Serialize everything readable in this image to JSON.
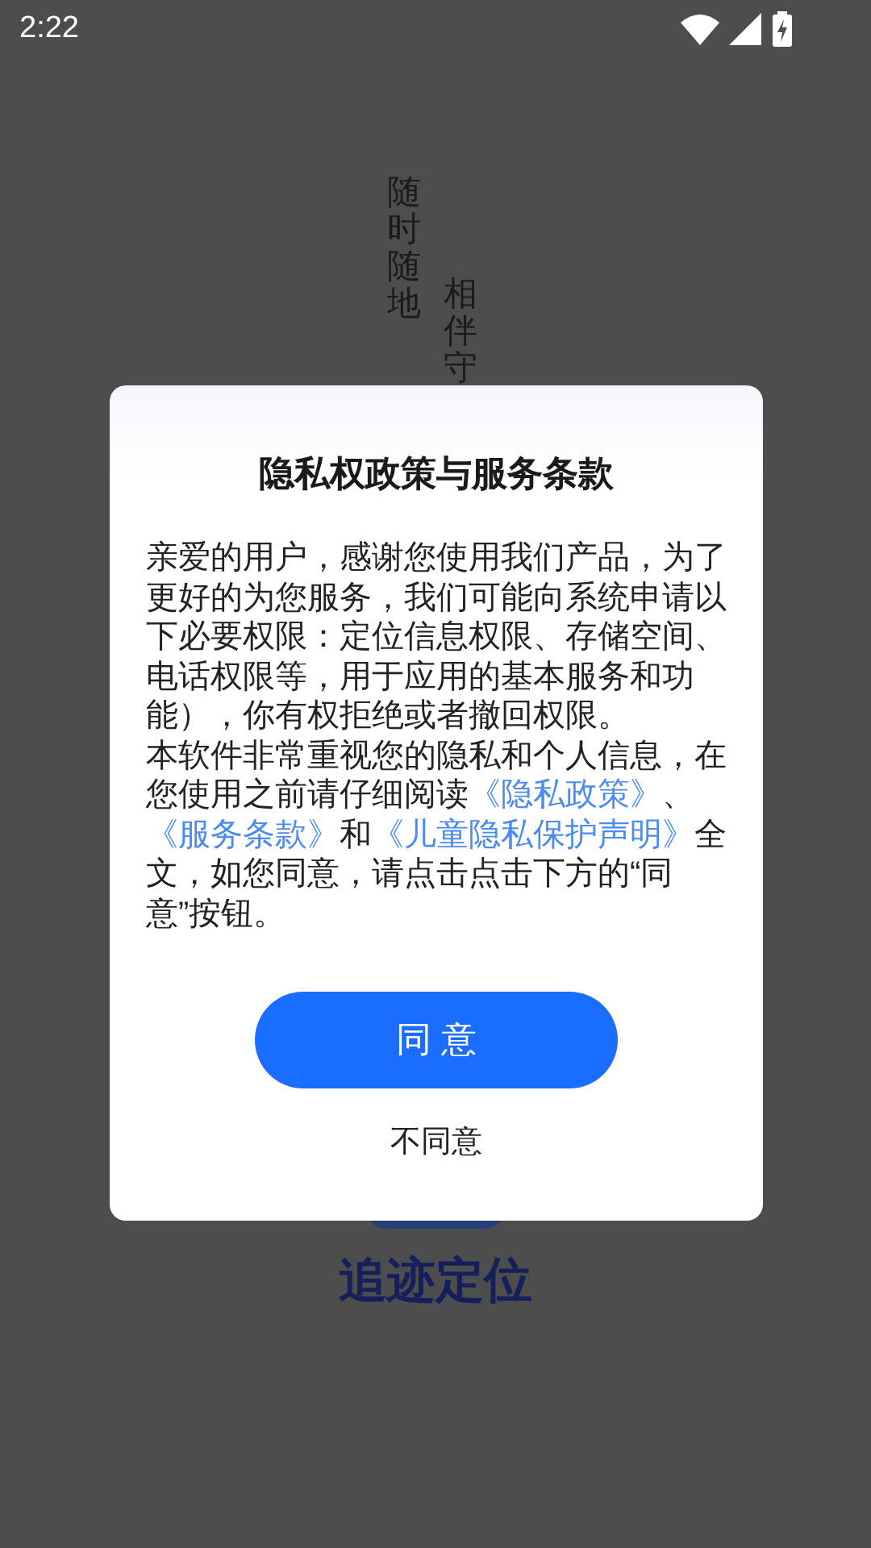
{
  "status_bar": {
    "time": "2:22"
  },
  "background": {
    "slogan_columns": [
      "随时随地",
      "相伴守"
    ],
    "title": "追迹定位"
  },
  "dialog": {
    "title": "隐私权政策与服务条款",
    "paragraphs": [
      [
        {
          "kind": "text",
          "text": "亲爱的用户，感谢您使用我们产品，为了更好的为您服务，我们可能向系统申请以下必要权限：定位信息权限、存储空间、电话权限等，用于应用的基本服务和功能），你有权拒绝或者撤回权限。"
        }
      ],
      [
        {
          "kind": "text",
          "text": "本软件非常重视您的隐私和个人信息，在您使用之前请仔细阅读"
        },
        {
          "kind": "link",
          "text": "《隐私政策》"
        },
        {
          "kind": "text",
          "text": "、"
        },
        {
          "kind": "link",
          "text": "《服务条款》"
        },
        {
          "kind": "text",
          "text": "和"
        },
        {
          "kind": "link",
          "text": "《儿童隐私保护声明》"
        },
        {
          "kind": "text",
          "text": "全文，如您同意，请点击点击下方的“同意”按钮。"
        }
      ]
    ],
    "agree_button": "同 意",
    "decline_button": "不同意"
  }
}
